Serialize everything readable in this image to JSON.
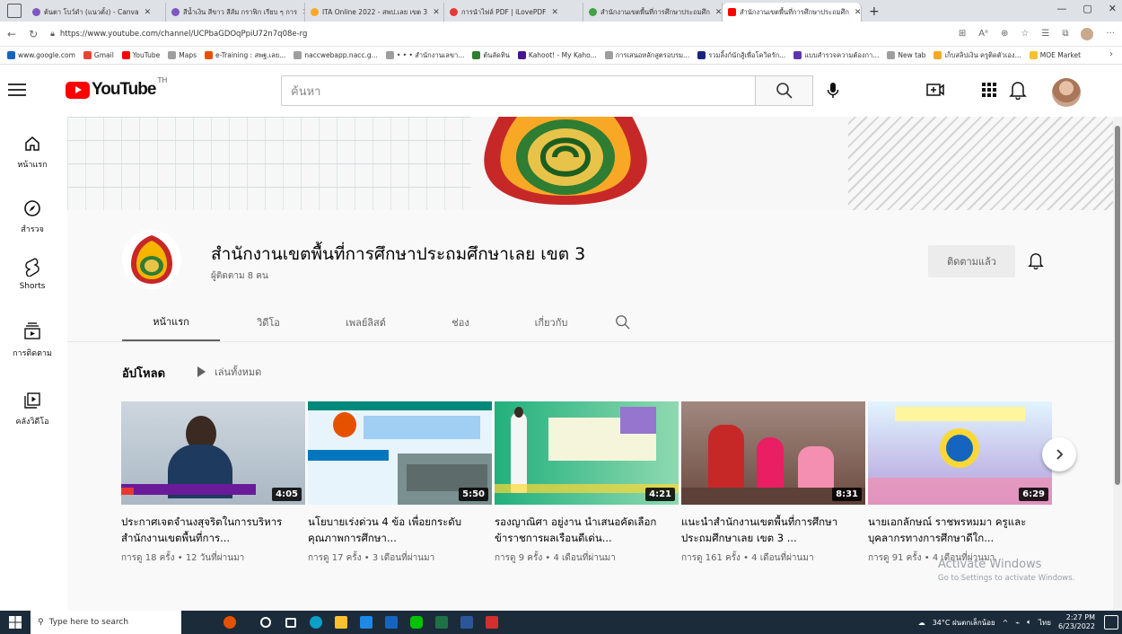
{
  "browser": {
    "tabs": [
      {
        "label": "ต้นตา โบว์ดำ (แนวตั้ง) - Canva",
        "color": "#7e57c2"
      },
      {
        "label": "สีน้ำเงิน สีขาว สีส้ม กราฟิก เรียบ ๆ การ",
        "color": "#7e57c2"
      },
      {
        "label": "ITA Online 2022 - สพป.เลย เขต 3",
        "color": "#f9a825"
      },
      {
        "label": "การนำไฟล์ PDF | iLovePDF",
        "color": "#e53935"
      },
      {
        "label": "สำนักงานเขตพื้นที่การศึกษาประถมศึก",
        "color": "#43a047"
      },
      {
        "label": "สำนักงานเขตพื้นที่การศึกษาประถมศึก",
        "color": "#ff0000"
      }
    ],
    "url": "https://www.youtube.com/channel/UCPbaGDOqPpiU72n7q08e-rg",
    "bookmarks": [
      {
        "label": "www.google.com",
        "color": "#1565c0"
      },
      {
        "label": "Gmail",
        "color": "#ea4335"
      },
      {
        "label": "YouTube",
        "color": "#ff0000"
      },
      {
        "label": "Maps",
        "color": "#9e9e9e"
      },
      {
        "label": "e-Training : สพฐ.เลย...",
        "color": "#e65100"
      },
      {
        "label": "naccwebapp.nacc.g...",
        "color": "#9e9e9e"
      },
      {
        "label": "• • • สำนักงานเลขา...",
        "color": "#9e9e9e"
      },
      {
        "label": "ต้นลัดทิน",
        "color": "#2e7d32"
      },
      {
        "label": "Kahoot! - My Kaho...",
        "color": "#46178f"
      },
      {
        "label": "การเสนอหลักสูตรอบรม...",
        "color": "#9e9e9e"
      },
      {
        "label": "รวมลิ้งก์นักสู้เพื่อโควิดรัก...",
        "color": "#1a237e"
      },
      {
        "label": "แบบสำรวจความต้องกา...",
        "color": "#5e35b1"
      },
      {
        "label": "New tab",
        "color": "#9e9e9e"
      },
      {
        "label": "เก็บสลิปเงิน ครูติดตัวเอง...",
        "color": "#f9a825"
      },
      {
        "label": "MOE Market",
        "color": "#fbc02d"
      }
    ]
  },
  "youtube": {
    "logo_text": "YouTube",
    "country": "TH",
    "search_placeholder": "ค้นหา"
  },
  "leftnav": [
    {
      "label": "หน้าแรก",
      "icon": "home-icon"
    },
    {
      "label": "สำรวจ",
      "icon": "explore-icon"
    },
    {
      "label": "Shorts",
      "icon": "shorts-icon"
    },
    {
      "label": "การติดตาม",
      "icon": "subscriptions-icon"
    },
    {
      "label": "คลังวิดีโอ",
      "icon": "library-icon"
    }
  ],
  "channel": {
    "name": "สำนักงานเขตพื้นที่การศึกษาประถมศึกษาเลย เขต 3",
    "subscribers": "ผู้ติดตาม 8 คน",
    "subscribe_label": "ติดตามแล้ว",
    "tabs": [
      "หน้าแรก",
      "วิดีโอ",
      "เพลย์ลิสต์",
      "ช่อง",
      "เกี่ยวกับ"
    ]
  },
  "shelf": {
    "title": "อัปโหลด",
    "play_all": "เล่นทั้งหมด"
  },
  "videos": [
    {
      "title": "ประกาศเจตจำนงสุจริตในการบริหารสำนักงานเขตพื้นที่การ...",
      "meta": "การดู 18 ครั้ง • 12 วันที่ผ่านมา",
      "duration": "4:05"
    },
    {
      "title": "นโยบายเร่งด่วน 4 ข้อ เพื่อยกระดับคุณภาพการศึกษา...",
      "meta": "การดู 17 ครั้ง • 3 เดือนที่ผ่านมา",
      "duration": "5:50"
    },
    {
      "title": "รองญาณิศา อยู่งาน นำเสนอคัดเลือกข้าราชการผลเรือนดีเด่น...",
      "meta": "การดู 9 ครั้ง • 4 เดือนที่ผ่านมา",
      "duration": "4:21"
    },
    {
      "title": "แนะนำสำนักงานเขตพื้นที่การศึกษาประถมศึกษาเลย เขต 3 ...",
      "meta": "การดู 161 ครั้ง • 4 เดือนที่ผ่านมา",
      "duration": "8:31"
    },
    {
      "title": "นายเอกลักษณ์ ราชพรหมมา ครูและบุคลากรทางการศึกษาดีใก...",
      "meta": "การดู 91 ครั้ง • 4 เดือนที่ผ่านมา",
      "duration": "6:29"
    }
  ],
  "watermark": {
    "line1": "Activate Windows",
    "line2": "Go to Settings to activate Windows."
  },
  "taskbar": {
    "search_placeholder": "Type here to search",
    "weather": "34°C ฝนตกเล็กน้อย",
    "lang": "ไทย",
    "time": "2:27 PM",
    "date": "6/23/2022"
  }
}
